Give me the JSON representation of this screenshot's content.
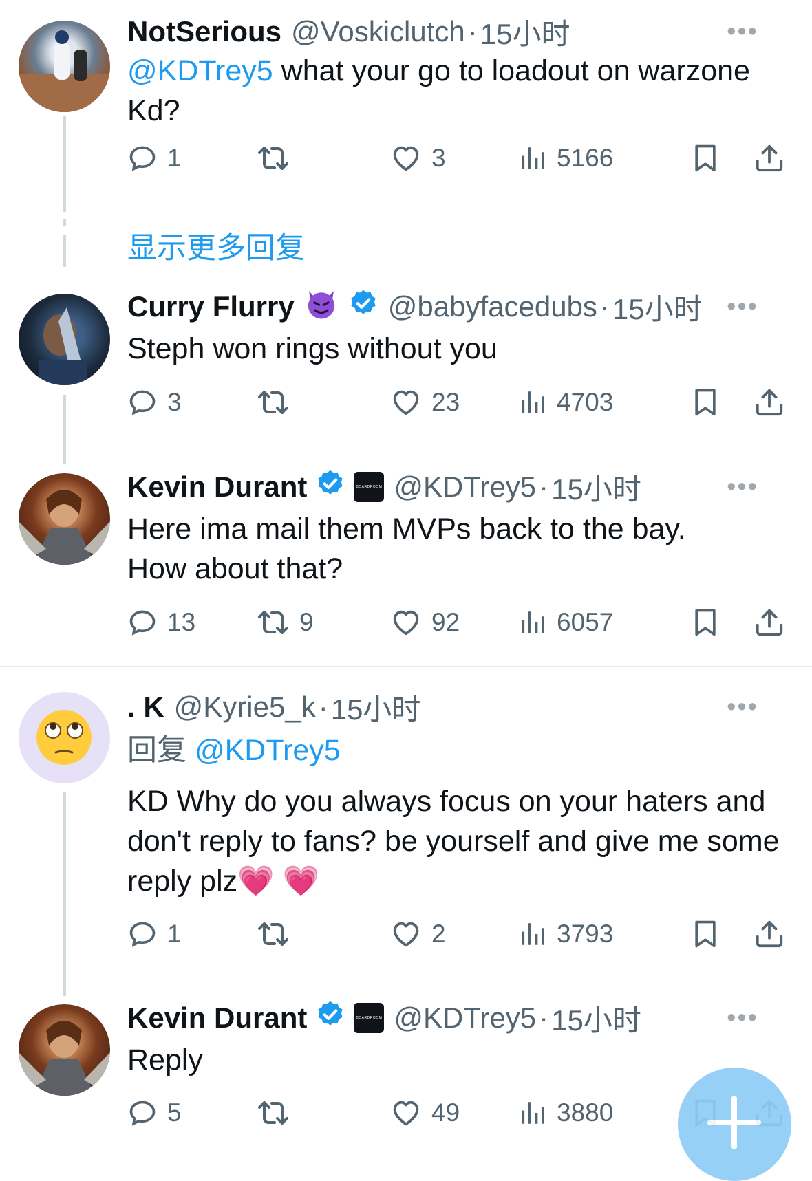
{
  "show_more_replies": "显示更多回复",
  "colors": {
    "accent": "#1d9bf0",
    "verified": "#1d9bf0",
    "text": "#0f1419",
    "muted": "#536471"
  },
  "icons": {
    "reply": "speech-bubble-icon",
    "retweet": "retweet-icon",
    "like": "heart-icon",
    "views": "bar-chart-icon",
    "bookmark": "bookmark-icon",
    "share": "share-upload-icon",
    "more": "more-dots-icon",
    "compose": "compose-plus-icon"
  },
  "tweets": [
    {
      "name": "NotSerious",
      "handle": "@Voskiclutch",
      "dot": "·",
      "time": "15小时",
      "more": "•••",
      "mention": "@KDTrey5",
      "text": " what your go to loadout on warzone Kd?",
      "replies": "1",
      "retweets": "",
      "likes": "3",
      "views": "5166"
    },
    {
      "name": "Curry Flurry",
      "name_emoji": "smiling-devil-emoji",
      "handle": "@babyfacedubs",
      "dot": "·",
      "time": "15小时",
      "more": "•••",
      "text": "Steph won rings without you",
      "replies": "3",
      "retweets": "",
      "likes": "23",
      "views": "4703"
    },
    {
      "name": "Kevin Durant",
      "affiliate": "BOARDROOM",
      "handle": "@KDTrey5",
      "dot": "·",
      "time": "15小时",
      "more": "•••",
      "text": "Here ima mail them MVPs back to the bay. How about that?",
      "replies": "13",
      "retweets": "9",
      "likes": "92",
      "views": "6057"
    },
    {
      "name": ". K",
      "handle": "@Kyrie5_k",
      "dot": "·",
      "time": "15小时",
      "more": "•••",
      "reply_prefix": "回复",
      "reply_to": "@KDTrey5",
      "text": "KD Why do you always focus on your haters and don't reply to fans? be yourself and give me some reply plz",
      "text_emoji": "💗 💗",
      "replies": "1",
      "retweets": "",
      "likes": "2",
      "views": "3793"
    },
    {
      "name": "Kevin Durant",
      "affiliate": "BOARDROOM",
      "handle": "@KDTrey5",
      "dot": "·",
      "time": "15小时",
      "more": "•••",
      "text": "Reply",
      "replies": "5",
      "retweets": "",
      "likes": "49",
      "views": "3880"
    }
  ]
}
